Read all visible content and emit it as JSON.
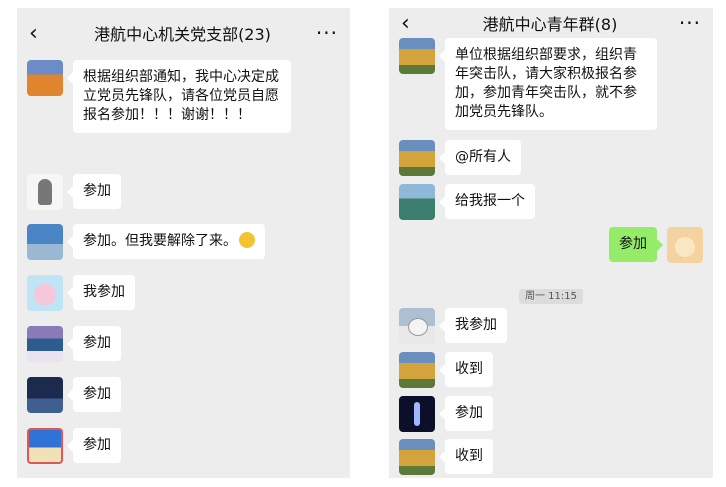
{
  "left_chat": {
    "back_icon": "chevron-left-icon",
    "title": "港航中心机关党支部(23)",
    "more_icon": "more-icon",
    "messages": [
      {
        "avatar": "field-avatar",
        "text": " 根据组织部通知，我中心决定成立党员先锋队，请各位党员自愿报名参加！！！谢谢！！！"
      },
      {
        "avatar": "sketch-avatar",
        "text": "参加"
      },
      {
        "avatar": "plane-avatar",
        "text": "参加。但我要解除了来。",
        "emoji": "smile-emoji"
      },
      {
        "avatar": "cake-avatar",
        "text": "我参加"
      },
      {
        "avatar": "lake-avatar",
        "text": "参加"
      },
      {
        "avatar": "bridge-avatar",
        "text": "参加"
      },
      {
        "avatar": "beach-avatar",
        "text": "参加"
      }
    ]
  },
  "right_chat": {
    "back_icon": "chevron-left-icon",
    "title": "港航中心青年群(8)",
    "more_icon": "more-icon",
    "timestamp": "周一 11:15",
    "messages": [
      {
        "avatar": "trees-avatar",
        "text": "单位根据组织部要求，组织青年突击队，请大家积极报名参加，参加青年突击队，就不参加党员先锋队。"
      },
      {
        "avatar": "trees-avatar",
        "text": "@所有人"
      },
      {
        "avatar": "pool-avatar",
        "text": "给我报一个"
      },
      {
        "avatar": "cartoon-avatar",
        "text": "参加",
        "sender": "me"
      },
      {
        "avatar": "seal-avatar",
        "text": "我参加"
      },
      {
        "avatar": "trees-avatar",
        "text": "收到"
      },
      {
        "avatar": "dancer-avatar",
        "text": "参加"
      },
      {
        "avatar": "trees-avatar",
        "text": "收到"
      }
    ]
  },
  "colors": {
    "chat_bg": "#ededed",
    "bubble_other": "#ffffff",
    "bubble_me": "#95ec69"
  }
}
